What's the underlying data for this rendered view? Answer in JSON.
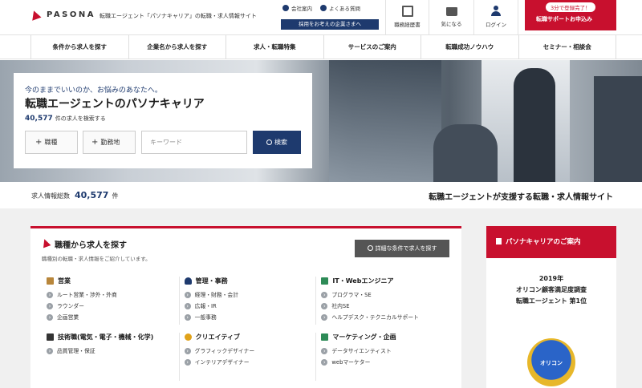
{
  "header": {
    "logo": "PASONA",
    "tagline": "転職エージェント「パソナキャリア」の転職・求人情報サイト",
    "links": [
      "会社案内",
      "よくある質問"
    ],
    "corp_button": "採用をお考えの企業さまへ",
    "resume_label": "職務経歴書",
    "favorite_label": "気になる",
    "login_label": "ログイン",
    "cta_badge": "3分で登録完了！",
    "cta_label": "転職サポートお申込み"
  },
  "nav": [
    "条件から求人を探す",
    "企業名から求人を探す",
    "求人・転職特集",
    "サービスのご案内",
    "転職成功ノウハウ",
    "セミナー・相談会"
  ],
  "hero": {
    "lead": "今のままでいいのか、お悩みのあなたへ。",
    "title": "転職エージェントのパソナキャリア",
    "count": "40,577",
    "count_suffix": "件の求人を検索する",
    "job_button": "職種",
    "location_button": "勤務地",
    "keyword_placeholder": "キーワード",
    "search_button": "検索"
  },
  "summary": {
    "label": "求人情報総数",
    "count": "40,577",
    "unit": "件",
    "tagline": "転職エージェントが支援する転職・求人情報サイト"
  },
  "job_panel": {
    "title": "職種から求人を探す",
    "subtitle": "職種別の転職・求人情報をご紹介しています。",
    "detail_button": "詳細な条件で求人を探す",
    "categories": [
      {
        "title": "営業",
        "icon": "briefcase-icon",
        "items": [
          "ルート営業・渉外・外商",
          "ラウンダー",
          "企画営業"
        ]
      },
      {
        "title": "管理・事務",
        "icon": "admin-icon",
        "items": [
          "経理・財務・会計",
          "広報・IR",
          "一般事務"
        ]
      },
      {
        "title": "IT・Webエンジニア",
        "icon": "monitor-icon",
        "items": [
          "プログラマ・SE",
          "社内SE",
          "ヘルプデスク・テクニカルサポート"
        ]
      },
      {
        "title": "技術職(電気・電子・機械・化学)",
        "icon": "gear-icon",
        "items": [
          "品質管理・保証"
        ]
      },
      {
        "title": "クリエイティブ",
        "icon": "lightbulb-icon",
        "items": [
          "グラフィックデザイナー",
          "インテリアデザイナー"
        ]
      },
      {
        "title": "マーケティング・企画",
        "icon": "chart-icon",
        "items": [
          "データサイエンティスト",
          "webマーケター"
        ]
      }
    ]
  },
  "sidebar": {
    "title": "パソナキャリアのご案内",
    "award_year": "2019年",
    "award_line1": "オリコン顧客満足度調査",
    "award_line2": "転職エージェント 第1位",
    "medal_text": "オリコン"
  }
}
